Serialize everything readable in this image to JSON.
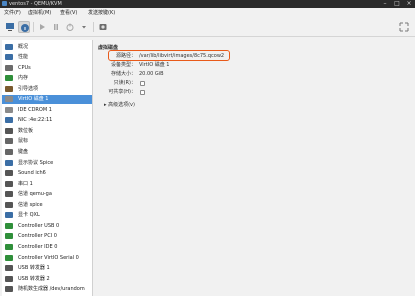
{
  "window": {
    "title": "ventos7 - QEMU/KVM"
  },
  "menubar": {
    "items": [
      "文件(F)",
      "虚拟机(M)",
      "查看(V)",
      "发送按键(K)"
    ]
  },
  "sidebar": {
    "items": [
      {
        "label": "概况",
        "icon": "monitor-icon",
        "color": "#3b6ea5"
      },
      {
        "label": "性能",
        "icon": "performance-icon",
        "color": "#3b6ea5"
      },
      {
        "label": "CPUs",
        "icon": "cpu-icon",
        "color": "#6b6b6b"
      },
      {
        "label": "内存",
        "icon": "memory-icon",
        "color": "#2f8f3a"
      },
      {
        "label": "引导选项",
        "icon": "boot-icon",
        "color": "#7a5a2e"
      },
      {
        "label": "VirtIO 磁盘 1",
        "icon": "disk-icon",
        "color": "#8a8a8a"
      },
      {
        "label": "IDE CDROM 1",
        "icon": "cdrom-icon",
        "color": "#8a8a8a"
      },
      {
        "label": "NIC :4e:22:11",
        "icon": "nic-icon",
        "color": "#3b6ea5"
      },
      {
        "label": "数位板",
        "icon": "tablet-icon",
        "color": "#555"
      },
      {
        "label": "鼠标",
        "icon": "mouse-icon",
        "color": "#666"
      },
      {
        "label": "键盘",
        "icon": "keyboard-icon",
        "color": "#666"
      },
      {
        "label": "显示协议 Spice",
        "icon": "display-icon",
        "color": "#3b6ea5"
      },
      {
        "label": "Sound ich6",
        "icon": "sound-icon",
        "color": "#555"
      },
      {
        "label": "串口 1",
        "icon": "serial-icon",
        "color": "#555"
      },
      {
        "label": "信道 qemu-ga",
        "icon": "channel-icon",
        "color": "#555"
      },
      {
        "label": "信道 spice",
        "icon": "channel-icon",
        "color": "#555"
      },
      {
        "label": "显卡 QXL",
        "icon": "video-icon",
        "color": "#3b6ea5"
      },
      {
        "label": "Controller USB 0",
        "icon": "controller-icon",
        "color": "#2f8f3a"
      },
      {
        "label": "Controller PCI 0",
        "icon": "controller-icon",
        "color": "#2f8f3a"
      },
      {
        "label": "Controller IDE 0",
        "icon": "controller-icon",
        "color": "#2f8f3a"
      },
      {
        "label": "Controller VirtIO Serial 0",
        "icon": "controller-icon",
        "color": "#2f8f3a"
      },
      {
        "label": "USB 转发器 1",
        "icon": "usb-icon",
        "color": "#555"
      },
      {
        "label": "USB 转发器 2",
        "icon": "usb-icon",
        "color": "#555"
      },
      {
        "label": "随机数生成器 /dev/urandom",
        "icon": "rng-icon",
        "color": "#555"
      }
    ],
    "selected_index": 5,
    "selected_color": "#4a90d9"
  },
  "detail": {
    "section_title": "虚拟磁盘",
    "fields": [
      {
        "label": "源路径：",
        "value": "/var/lib/libvirt/images/8c75.qcow2"
      },
      {
        "label": "设备类型：",
        "value": "VirtIO 磁盘 1"
      },
      {
        "label": "存储大小：",
        "value": "20.00 GiB"
      },
      {
        "label": "只读(R)：",
        "value": ""
      },
      {
        "label": "可共享(H)：",
        "value": ""
      }
    ],
    "advanced_label": "▸ 高级选项(v)",
    "highlight_color": "#e85a1a"
  }
}
